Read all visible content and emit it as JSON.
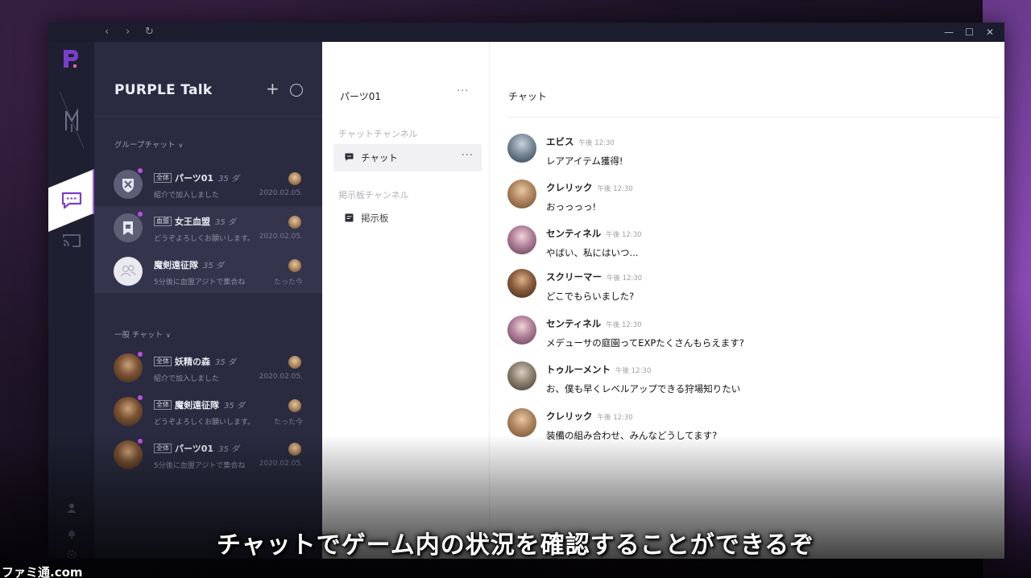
{
  "app": {
    "title": "PURPLE Talk"
  },
  "group_section": {
    "label": "グループチャット"
  },
  "general_section": {
    "label": "一般 チャット"
  },
  "group_chats": [
    {
      "tag": "全体",
      "name": "パーツ01",
      "count": "35 ダ",
      "subtitle": "紹介で加入しました",
      "date": "2020.02.05."
    },
    {
      "tag": "血盟",
      "name": "女王血盟",
      "count": "35 ダ",
      "subtitle": "どうぞよろしくお願いします。",
      "date": "2020.02.05."
    },
    {
      "tag": "",
      "name": "魔剣遠征隊",
      "count": "35 ダ",
      "subtitle": "5分後に血盟アジトで集合ね",
      "date": "たった今"
    }
  ],
  "general_chats": [
    {
      "tag": "全体",
      "name": "妖精の森",
      "count": "35 ダ",
      "subtitle": "紹介で加入しました",
      "date": "2020.02.05."
    },
    {
      "tag": "全体",
      "name": "魔剣遠征隊",
      "count": "35 ダ",
      "subtitle": "どうぞよろしくお願いします。",
      "date": "たった今"
    },
    {
      "tag": "全体",
      "name": "パーツ01",
      "count": "35 ダ",
      "subtitle": "5分後に血盟アジトで集合ね",
      "date": "2020.02.05."
    }
  ],
  "channels": {
    "group_name": "パーツ01",
    "more_label": "···",
    "chat_section": "チャットチャンネル",
    "chat_channel": "チャット",
    "board_section": "掲示板チャンネル",
    "board_channel": "掲示板"
  },
  "chat": {
    "title": "チャット",
    "messages": [
      {
        "name": "エビス",
        "time": "午後 12:30",
        "text": "レアアイテム獲得!"
      },
      {
        "name": "クレリック",
        "time": "午後 12:30",
        "text": "おっっっっ!"
      },
      {
        "name": "センティネル",
        "time": "午後 12:30",
        "text": "やばい、私にはいつ..."
      },
      {
        "name": "スクリーマー",
        "time": "午後 12:30",
        "text": "どこでもらいました?"
      },
      {
        "name": "センティネル",
        "time": "午後 12:30",
        "text": "メデューサの庭園ってEXPたくさんもらえます?"
      },
      {
        "name": "トゥルーメント",
        "time": "午後 12:30",
        "text": "お、僕も早くレベルアップできる狩場知りたい"
      },
      {
        "name": "クレリック",
        "time": "午後 12:30",
        "text": "装備の組み合わせ、みんなどうしてます?"
      }
    ]
  },
  "caption": "チャットでゲーム内の状況を確認することができるぞ",
  "watermark": "ファミ通.com",
  "colors": {
    "accent": "#a35bd6",
    "unread_dot": "#c04fe0",
    "sidebar_bg": "#2a2b40",
    "rail_bg": "#1e1f30"
  }
}
